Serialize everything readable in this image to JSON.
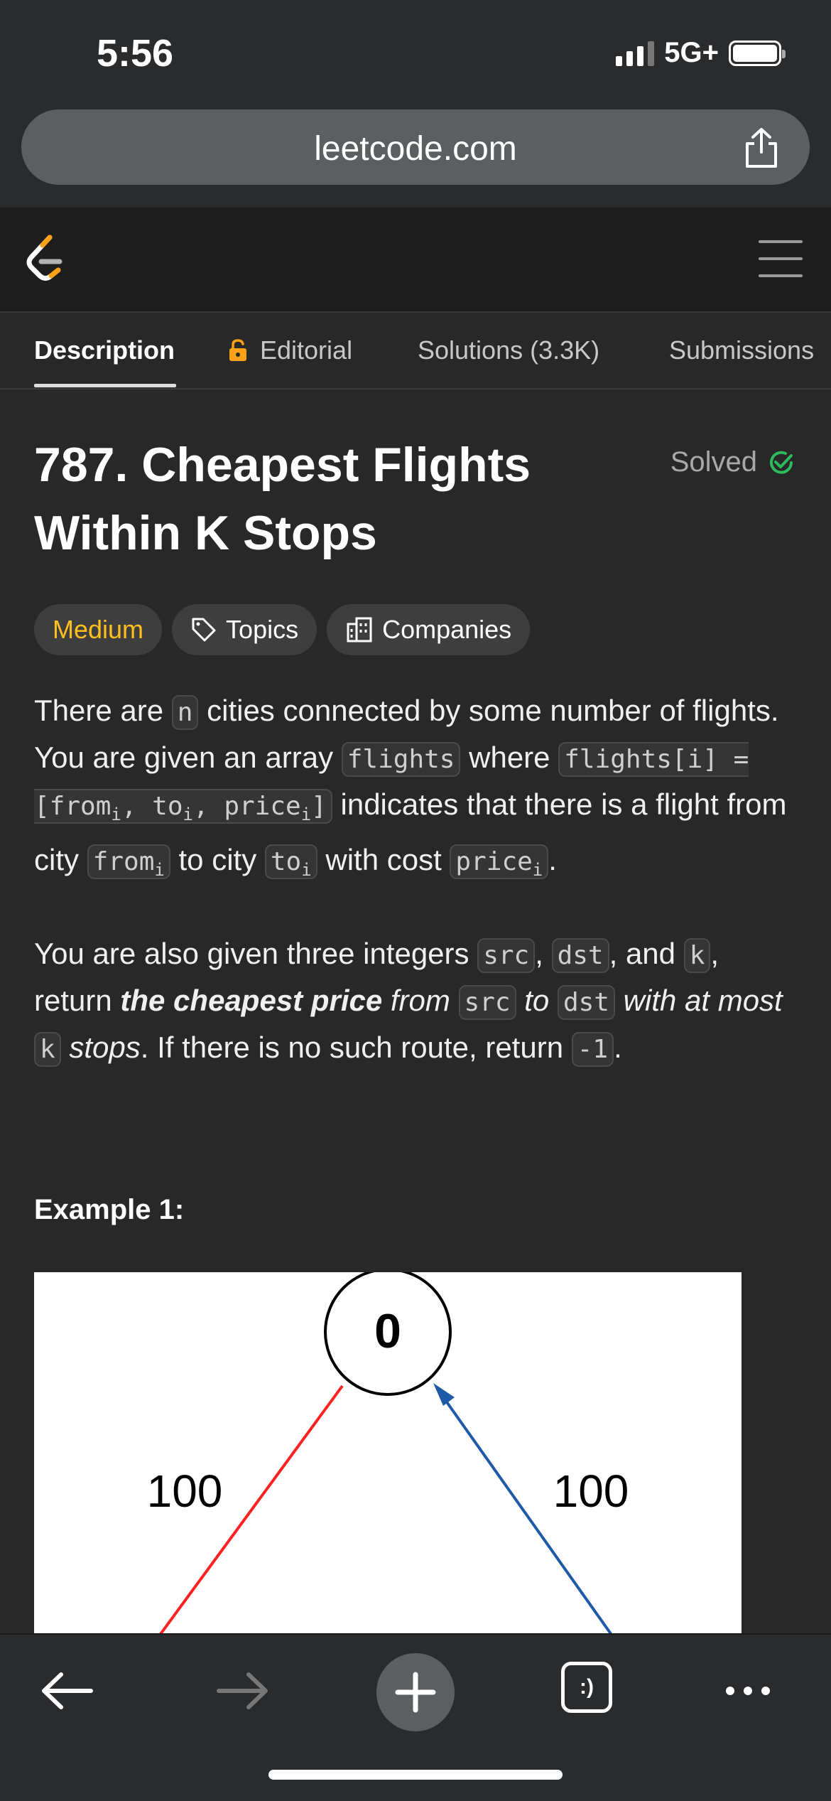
{
  "status": {
    "time": "5:56",
    "network": "5G+"
  },
  "browser": {
    "url": "leetcode.com",
    "tabs_label": ":)"
  },
  "tabs": [
    {
      "label": "Description"
    },
    {
      "label": "Editorial"
    },
    {
      "label": "Solutions (3.3K)"
    },
    {
      "label": "Submissions"
    }
  ],
  "problem": {
    "title_line1": "787. Cheapest Flights",
    "title_line2": "Within K Stops",
    "solved_label": "Solved",
    "difficulty": "Medium",
    "topics_label": "Topics",
    "companies_label": "Companies"
  },
  "description": {
    "p1": {
      "t1": "There are ",
      "c_n": "n",
      "t2": " cities connected by some number of flights. You are given an array ",
      "c_flights": "flights",
      "t3": " where ",
      "c_flights_def_a": "flights[i] = [from",
      "c_flights_def_b": ", to",
      "c_flights_def_c": ", price",
      "c_flights_def_d": "]",
      "sub_i": "i",
      "t4": " indicates that there is a flight from city ",
      "c_from": "from",
      "t5": " to city ",
      "c_to": "to",
      "t6": " with cost ",
      "c_price": "price",
      "t7": "."
    },
    "p2": {
      "t1": "You are also given three integers ",
      "c_src": "src",
      "t2": ", ",
      "c_dst": "dst",
      "t3": ", and ",
      "c_k": "k",
      "t4": ", return ",
      "bold": "the cheapest price",
      "i1": " from ",
      "i2": " to ",
      "i3": " with at most ",
      "i4": " stops",
      "t5": ". If there is no such route, return ",
      "c_neg1": "-1",
      "t6": "."
    }
  },
  "example_heading": "Example 1:",
  "figure": {
    "node_label": "0",
    "edge_left_label": "100",
    "edge_right_label": "100",
    "colors": {
      "left_edge": "#ff2020",
      "right_edge": "#1e5aa8"
    }
  },
  "colors": {
    "difficulty_medium": "#ffc01e",
    "solved_green": "#2cbb5d",
    "logo_orange": "#ffa116"
  }
}
